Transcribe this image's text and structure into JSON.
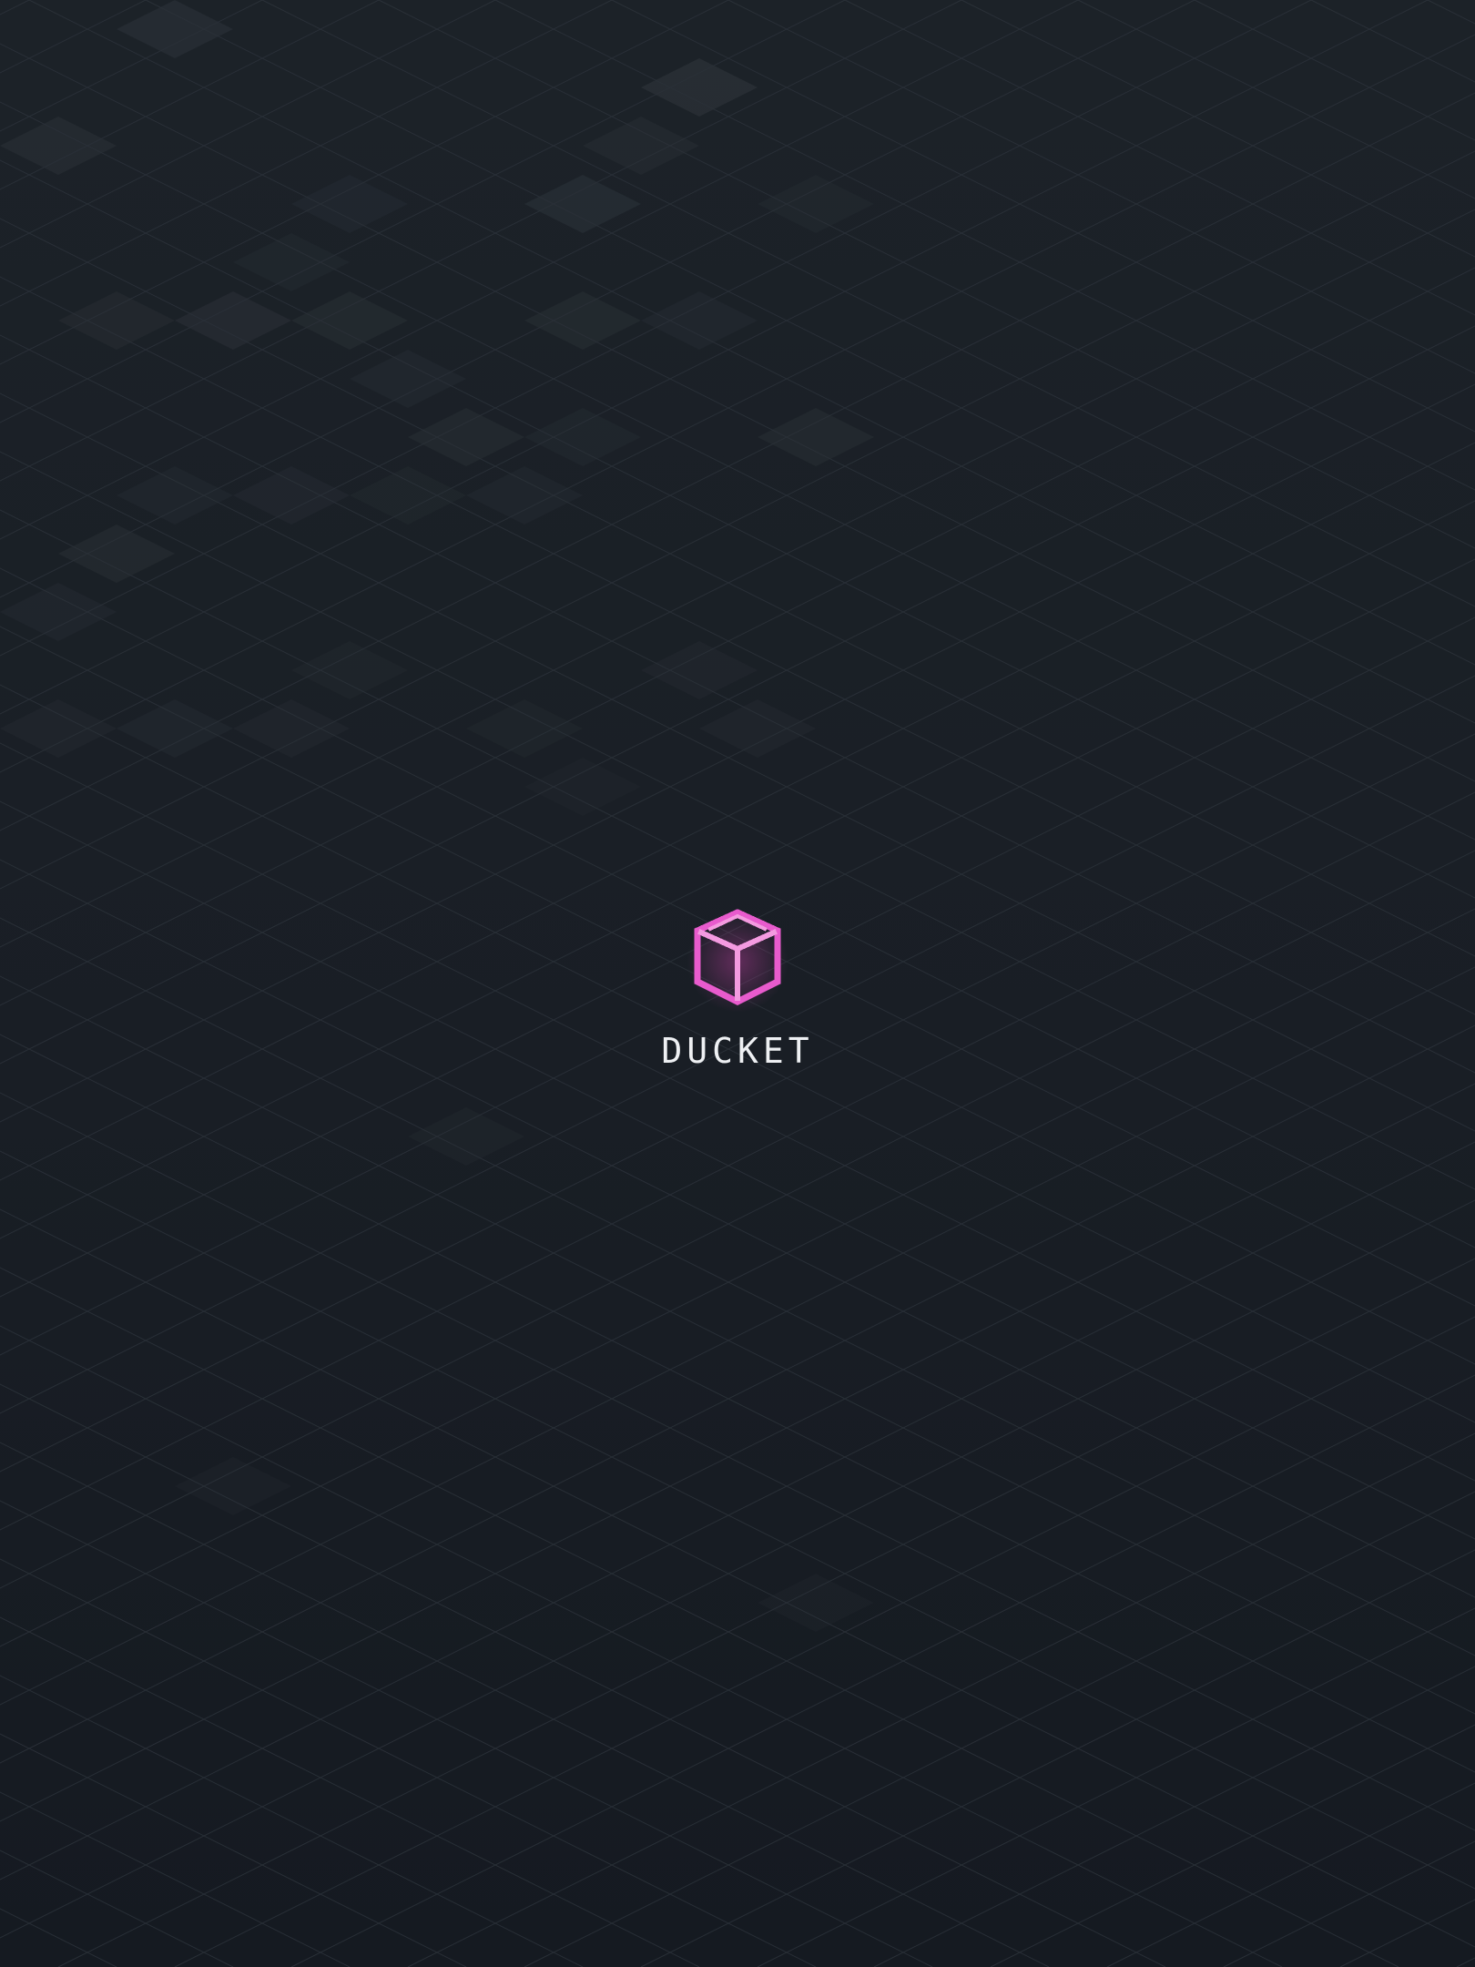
{
  "app": {
    "name": "DUCKET",
    "icon": "isometric-box-icon"
  },
  "theme": {
    "background": "#1a1f26",
    "grid_line": "#2a3038",
    "tile_highlight": "#2c3238",
    "tile_green_tint": "#252c28",
    "accent": "#e85bcd",
    "accent_light": "#f49ae0",
    "text": "#eef0f3"
  }
}
